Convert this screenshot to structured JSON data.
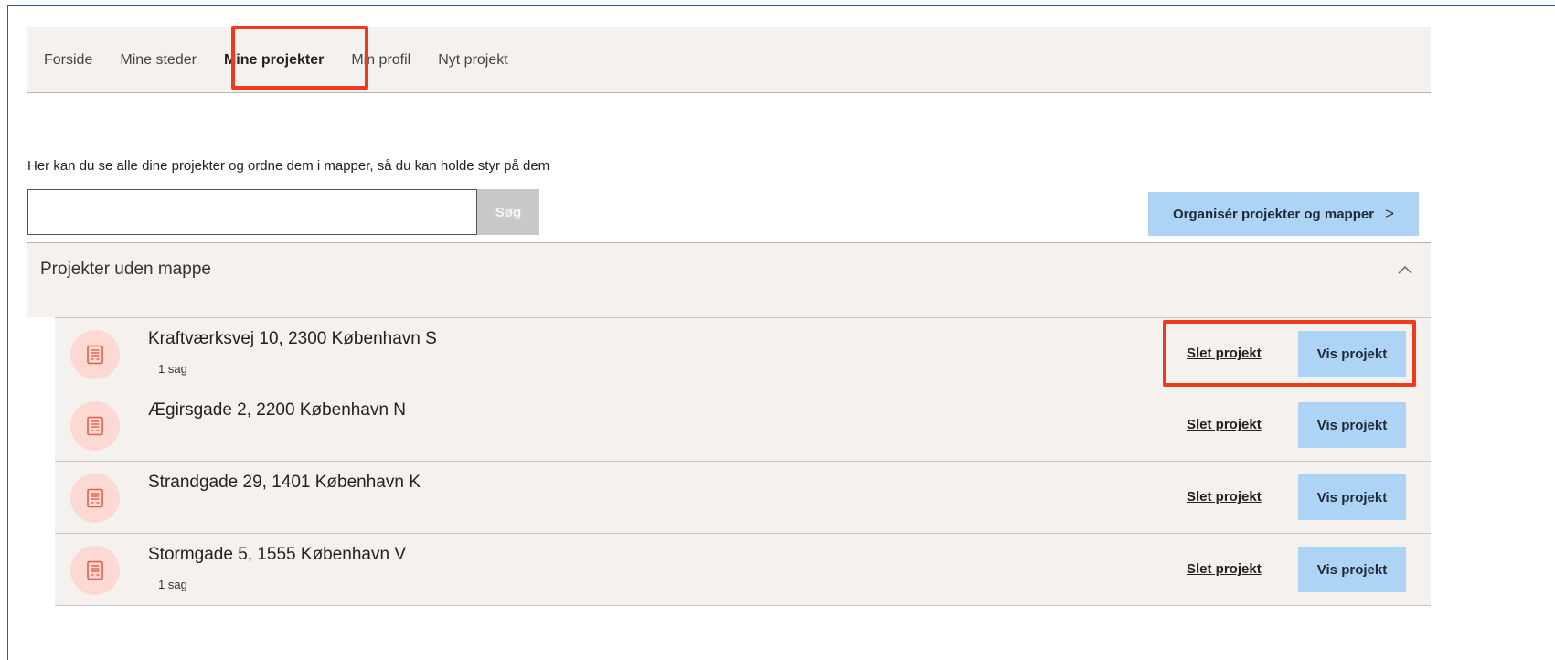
{
  "nav": {
    "items": [
      {
        "label": "Forside",
        "active": false
      },
      {
        "label": "Mine steder",
        "active": false
      },
      {
        "label": "Mine projekter",
        "active": true
      },
      {
        "label": "Min profil",
        "active": false
      },
      {
        "label": "Nyt projekt",
        "active": false
      }
    ]
  },
  "intro": "Her kan du se alle dine projekter og ordne dem i mapper, så du kan holde styr på dem",
  "search": {
    "value": "",
    "button_label": "Søg"
  },
  "organize_button": {
    "label": "Organisér projekter og mapper",
    "chevron": ">"
  },
  "folder": {
    "title": "Projekter uden mappe",
    "chevron": "^"
  },
  "projects": [
    {
      "title": "Kraftværksvej 10, 2300 København S",
      "sub": "1 sag",
      "delete_label": "Slet projekt",
      "view_label": "Vis projekt"
    },
    {
      "title": "Ægirsgade 2, 2200 København N",
      "sub": "",
      "delete_label": "Slet projekt",
      "view_label": "Vis projekt"
    },
    {
      "title": "Strandgade 29, 1401 København K",
      "sub": "",
      "delete_label": "Slet projekt",
      "view_label": "Vis projekt"
    },
    {
      "title": "Stormgade 5, 1555 København V",
      "sub": "1 sag",
      "delete_label": "Slet projekt",
      "view_label": "Vis projekt"
    }
  ],
  "colors": {
    "highlight": "#f03a1e",
    "button_blue": "#aed4f5",
    "panel_bg": "#f5f1ee",
    "icon_circle": "#fcd9d2",
    "icon_stroke": "#e0604a"
  },
  "icons": {
    "project": "document-icon"
  }
}
